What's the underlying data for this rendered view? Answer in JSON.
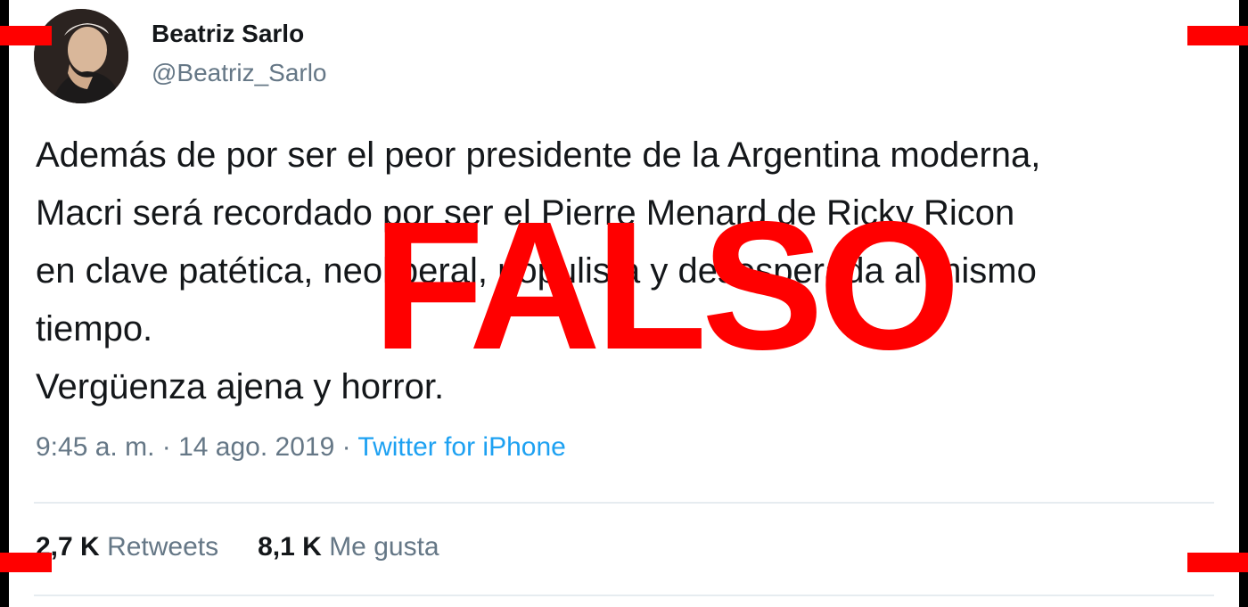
{
  "tweet": {
    "author": {
      "display_name": "Beatriz Sarlo",
      "handle": "@Beatriz_Sarlo"
    },
    "text_lines": [
      "Además de por ser el peor presidente de la Argentina moderna,",
      "Macri será recordado por ser el Pierre Menard de Ricky Ricon",
      "en clave patética, neoliberal, populista y desesperada al mismo",
      "tiempo.",
      "Vergüenza ajena y horror."
    ],
    "time": "9:45 a. m.",
    "date": "14 ago. 2019",
    "separator": "·",
    "source": "Twitter for iPhone",
    "retweets_count": "2,7 K",
    "retweets_label": "Retweets",
    "likes_count": "8,1 K",
    "likes_label": "Me gusta"
  },
  "stamp": {
    "label": "FALSO",
    "color": "#ff0000"
  },
  "colors": {
    "text": "#14171a",
    "secondary": "#657786",
    "link": "#1da1f2",
    "divider": "#e6ecf0"
  }
}
